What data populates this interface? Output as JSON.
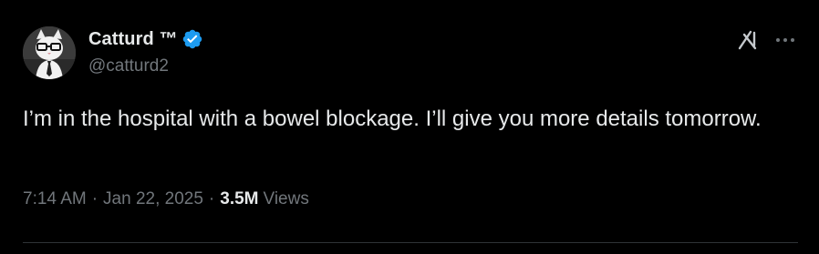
{
  "tweet": {
    "author": {
      "display_name": "Catturd ™",
      "handle": "@catturd2",
      "verified": true
    },
    "text": "I’m in the hospital with a bowel blockage. I’ll give you more details tomorrow.",
    "meta": {
      "time": "7:14 AM",
      "separator": "·",
      "date": "Jan 22, 2025",
      "views_count": "3.5M",
      "views_label": "Views"
    }
  },
  "icons": {
    "verified": "verified-badge-icon",
    "grok": "grok-icon",
    "more": "more-options-icon"
  },
  "colors": {
    "background": "#000000",
    "primary_text": "#e7e9ea",
    "secondary_text": "#71767b",
    "verified_blue": "#1d9bf0",
    "divider": "#2f3336"
  }
}
